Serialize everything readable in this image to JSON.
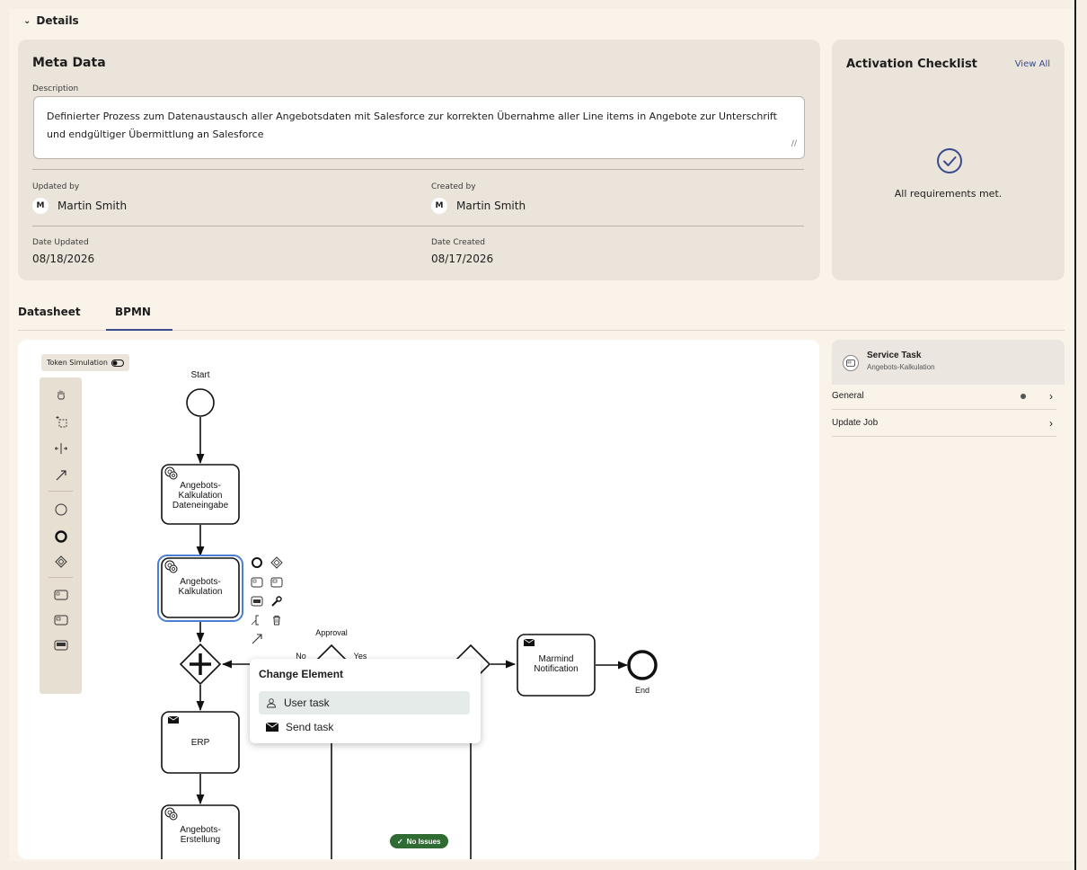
{
  "details": {
    "title": "Details"
  },
  "meta": {
    "title": "Meta Data",
    "description_label": "Description",
    "description": "Definierter Prozess zum Datenaustausch aller Angebotsdaten mit Salesforce zur korrekten Übernahme aller Line items in Angebote zur Unterschrift und endgültiger Übermittlung an Salesforce",
    "updated_by_label": "Updated by",
    "updated_by": "Martin Smith",
    "updated_by_initial": "M",
    "created_by_label": "Created by",
    "created_by": "Martin Smith",
    "created_by_initial": "M",
    "date_updated_label": "Date Updated",
    "date_updated": "08/18/2026",
    "date_created_label": "Date Created",
    "date_created": "08/17/2026"
  },
  "checklist": {
    "title": "Activation Checklist",
    "view_all": "View All",
    "message": "All requirements met."
  },
  "tabs": [
    {
      "label": "Datasheet",
      "active": false
    },
    {
      "label": "BPMN",
      "active": true
    }
  ],
  "bpmn": {
    "token_simulation": "Token Simulation",
    "labels": {
      "start": "Start",
      "task1": [
        "Angebots-",
        "Kalkulation",
        "Dateneingabe"
      ],
      "task2": [
        "Angebots-",
        "Kalkulation"
      ],
      "approval": "Approval",
      "no": "No",
      "yes": "Yes",
      "marmind": [
        "Marmind",
        "Notification"
      ],
      "end": "End",
      "erp": "ERP",
      "task3": [
        "Angebots-",
        "Erstellung"
      ]
    },
    "popup": {
      "title": "Change Element",
      "items": [
        {
          "label": "User task",
          "icon": "user-task-icon",
          "highlighted": true
        },
        {
          "label": "Send task",
          "icon": "envelope-icon",
          "highlighted": false
        }
      ]
    },
    "issues_badge": "No Issues",
    "palette_icons": [
      "hand-tool-icon",
      "lasso-tool-icon",
      "space-tool-icon",
      "connect-tool-icon",
      "start-event-icon",
      "end-event-icon",
      "gateway-icon",
      "task-icon",
      "subprocess-icon",
      "data-store-icon"
    ]
  },
  "properties": {
    "title": "Service Task",
    "subtitle": "Angebots-Kalkulation",
    "rows": [
      {
        "label": "General",
        "has_dot": true
      },
      {
        "label": "Update Job",
        "has_dot": false
      }
    ]
  },
  "colors": {
    "accent": "#3a4a8a",
    "selection": "#4a7fd4",
    "success": "#2f6b33",
    "background": "#f6efe6",
    "card": "#ebe4da"
  }
}
